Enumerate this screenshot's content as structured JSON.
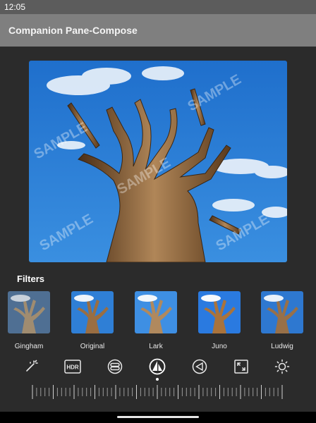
{
  "status_bar": {
    "time": "12:05"
  },
  "app_bar": {
    "title": "Companion Pane-Compose"
  },
  "photo": {
    "watermark": "SAMPLE"
  },
  "filters": {
    "title": "Filters",
    "items": [
      {
        "label": "Gingham"
      },
      {
        "label": "Original"
      },
      {
        "label": "Lark"
      },
      {
        "label": "Juno"
      },
      {
        "label": "Ludwig"
      }
    ]
  },
  "tools": [
    {
      "icon": "magic-wand-icon"
    },
    {
      "icon": "hdr-icon"
    },
    {
      "icon": "filter-layers-icon"
    },
    {
      "icon": "tonality-icon",
      "selected": true
    },
    {
      "icon": "vignette-icon"
    },
    {
      "icon": "crop-expand-icon"
    },
    {
      "icon": "brightness-icon"
    }
  ],
  "colors": {
    "background": "#2b2b2b",
    "app_bar": "#7f7f7f",
    "status_bar": "#5c5c5c",
    "sky": "#2d7fd6"
  }
}
